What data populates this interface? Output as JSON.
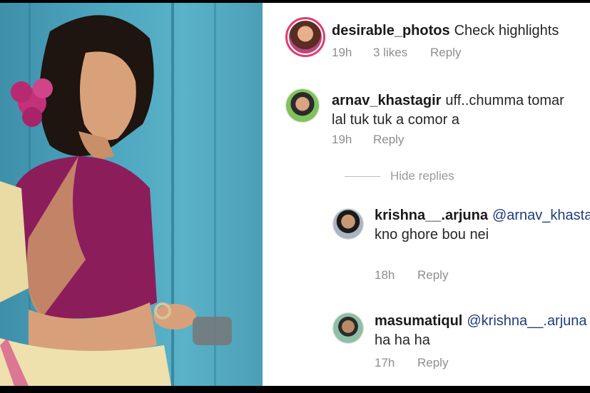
{
  "comments": [
    {
      "username": "desirable_photos",
      "text": "Check highlights",
      "time": "19h",
      "likes": "3 likes",
      "reply": "Reply"
    },
    {
      "username": "arnav_khastagir",
      "text": "uff..chumma tomar lal tuk tuk a comor a",
      "time": "19h",
      "reply": "Reply"
    }
  ],
  "hide_replies": "Hide replies",
  "replies": [
    {
      "username": "krishna__.arjuna",
      "mention": "@arnav_khastagir",
      "text": "kno ghore bou nei",
      "time": "18h",
      "reply": "Reply"
    },
    {
      "username": "masumatiqul",
      "mention": "@krishna__.arjuna",
      "text": "ha ha ha",
      "time": "17h",
      "reply": "Reply"
    }
  ],
  "colors": {
    "background_photo": "#4aa3bd",
    "story_ring": "#e23a73",
    "meta_text": "#8e8e8e",
    "mention": "#1f3c7a"
  },
  "icons": {
    "avatar_1": "avatar-story",
    "avatar_2": "avatar",
    "avatar_3": "avatar",
    "avatar_4": "avatar"
  }
}
